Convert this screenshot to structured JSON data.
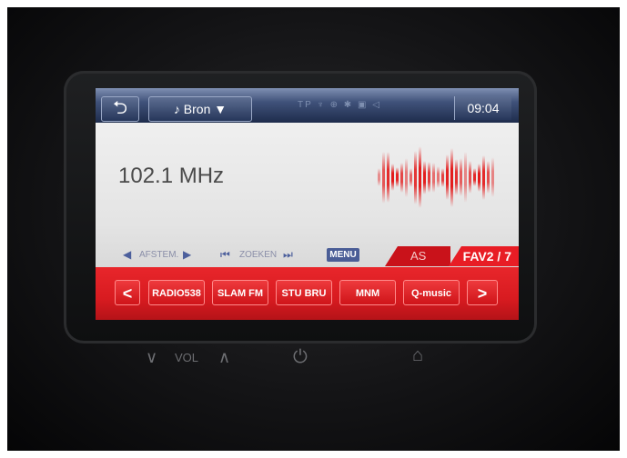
{
  "status_bar": {
    "back_icon": "back-arrow-icon",
    "source_label": "♪ Bron ▼",
    "indicators": "TP ♆ ⊕ ✱ ▣ ◁",
    "clock": "09:04"
  },
  "radio": {
    "frequency": "102.1 MHz"
  },
  "controls": {
    "tune_label": "AFSTEM.",
    "seek_label": "ZOEKEN",
    "menu_label": "MENU",
    "as_label": "AS",
    "fav_label": "FAV2 / 7"
  },
  "presets": {
    "prev_label": "<",
    "next_label": ">",
    "items": [
      "RADIO538",
      "SLAM FM",
      "STU BRU",
      "MNM",
      "Q-music"
    ]
  },
  "hardware": {
    "vol_label": "VOL"
  },
  "colors": {
    "accent_red": "#e31b1b",
    "status_blue": "#2d3d63"
  }
}
